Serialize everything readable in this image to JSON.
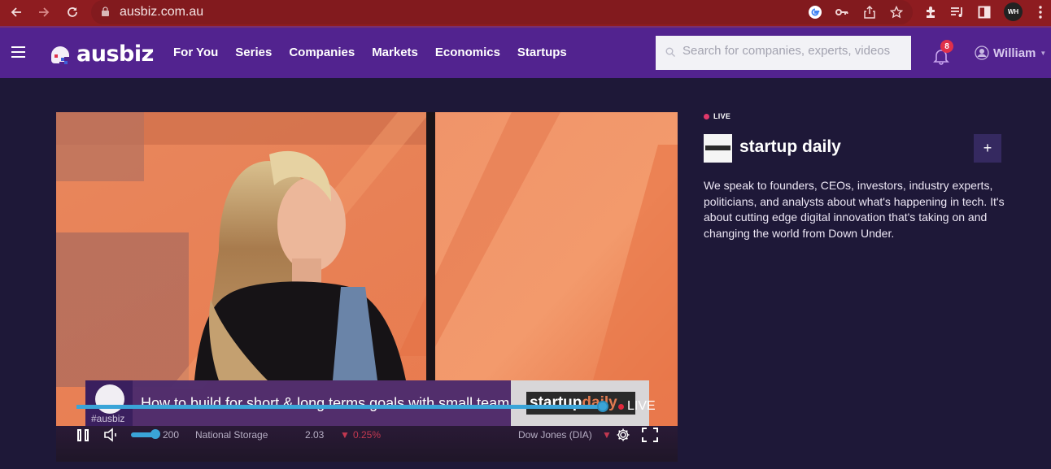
{
  "browser": {
    "url": "ausbiz.com.au",
    "profile_initials": "WH",
    "toolbar_icons": [
      "back-icon",
      "forward-icon",
      "reload-icon",
      "lock-icon",
      "google-icon",
      "key-icon",
      "share-icon",
      "star-icon",
      "extensions-icon",
      "media-icon",
      "sidepanel-icon",
      "menu-icon"
    ]
  },
  "header": {
    "logo_text": "ausbiz",
    "nav": [
      "For You",
      "Series",
      "Companies",
      "Markets",
      "Economics",
      "Startups"
    ],
    "search_placeholder": "Search for companies, experts, videos",
    "notifications_count": "8",
    "user_name": "William"
  },
  "player": {
    "headline": "How to build for short & long terms goals with small team",
    "hashtag": "#ausbiz",
    "brand_box_text": "startup",
    "brand_box_accent": "daily",
    "live_label": "LIVE",
    "progress_fraction": 0.97,
    "ticker": [
      {
        "symbol_partial": "200",
        "name": "National Storage",
        "price": "2.03",
        "change": "0.25%",
        "direction": "down"
      },
      {
        "name": "Dow Jones (DIA)",
        "change_partial": "%",
        "direction": "down"
      }
    ],
    "controls": [
      "pause-icon",
      "volume-icon",
      "settings-icon",
      "fullscreen-icon"
    ]
  },
  "side": {
    "live_label": "LIVE",
    "show_title": "startup daily",
    "follow_label": "+",
    "description": "We speak to founders, CEOs, investors, industry experts, politicians, and analysts about what's happening in tech. It's about cutting edge digital innovation that's taking on and changing the world from Down Under."
  },
  "colors": {
    "chrome_red": "#8e1c20",
    "header_purple": "#52238f",
    "page_bg": "#1e1838",
    "live_red": "#e0386a",
    "progress_blue": "#3aa4d8",
    "badge_red": "#e0304a"
  }
}
